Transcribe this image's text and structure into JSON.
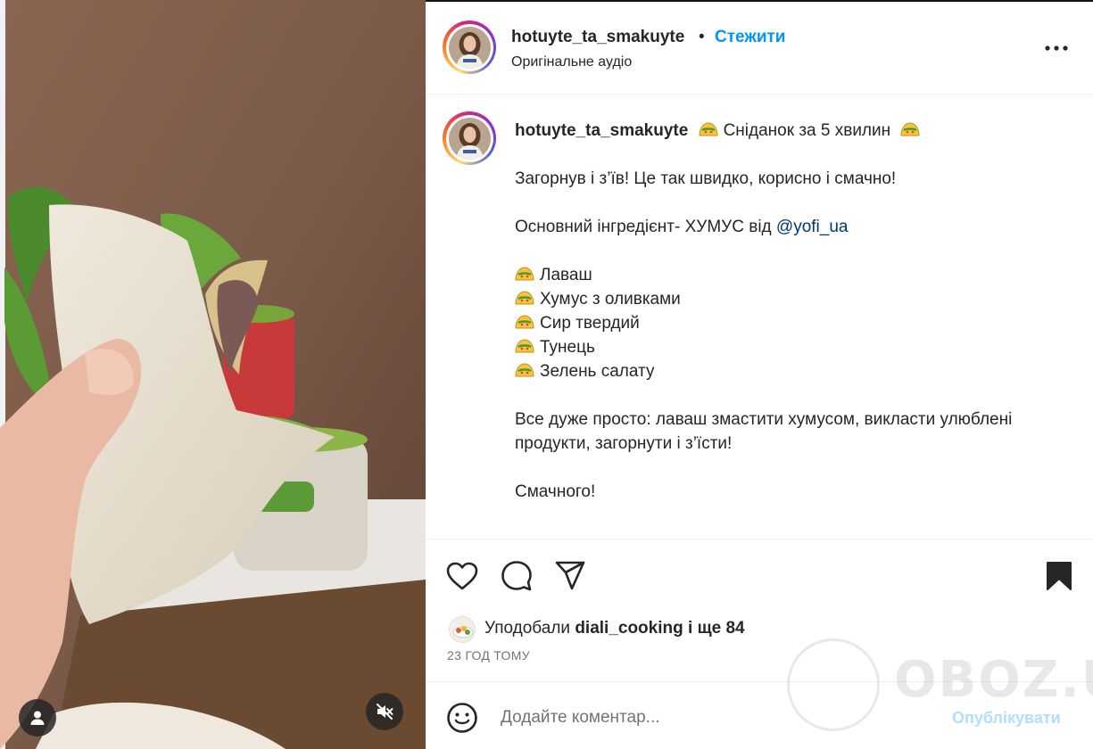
{
  "header": {
    "username": "hotuyte_ta_smakuyte",
    "dot": "•",
    "follow_label": "Стежити",
    "subtitle": "Оригінальне аудіо"
  },
  "caption": {
    "username": "hotuyte_ta_smakuyte",
    "title": "Сніданок за 5 хвилин",
    "line1": "Загорнув і з’їв! Це так швидко, корисно і смачно!",
    "line2_prefix": "Основний інгредієнт- ХУМУС від ",
    "mention": "@yofi_ua",
    "ingredients": [
      "Лаваш",
      "Хумус з оливками",
      "Сир твердий",
      "Тунець",
      "Зелень салату"
    ],
    "line3": "Все дуже просто: лаваш змастити хумусом, викласти улюблені продукти, загорнути і з’їсти!",
    "line4": "Смачного!",
    "emoji_name": "taco-emoji"
  },
  "likes": {
    "prefix": "Уподобали ",
    "user": "diali_cooking",
    "suffix": " і ще 84"
  },
  "time": "23 ГОД ТОМУ",
  "comment": {
    "placeholder": "Додайте коментар...",
    "publish_label": "Опублікувати"
  },
  "watermark": "OBOZ.UA",
  "colors": {
    "accent": "#0095f6",
    "publish_disabled": "#b2dffc",
    "mention": "#00376b",
    "text": "#262626",
    "secondary": "#737373"
  },
  "icons": [
    "more-icon",
    "heart-icon",
    "comment-icon",
    "share-icon",
    "bookmark-icon",
    "emoji-icon",
    "user-tag-icon",
    "mute-icon"
  ]
}
